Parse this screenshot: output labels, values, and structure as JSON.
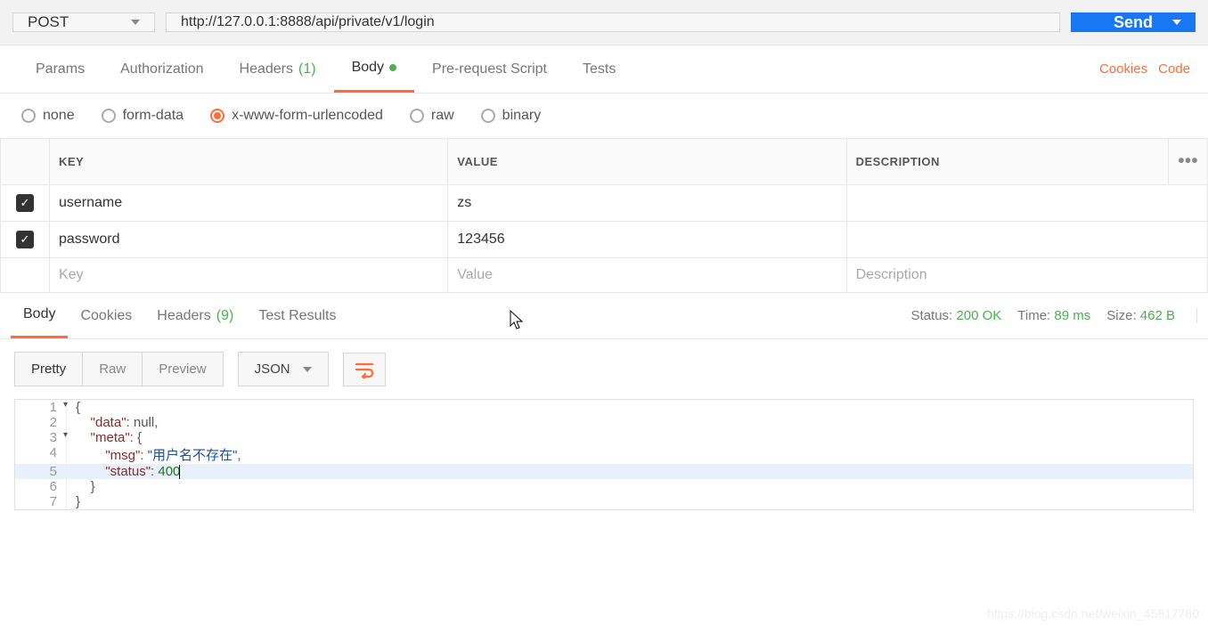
{
  "request": {
    "method": "POST",
    "url": "http://127.0.0.1:8888/api/private/v1/login",
    "send_label": "Send"
  },
  "tabs": {
    "params": "Params",
    "authorization": "Authorization",
    "headers": "Headers",
    "headers_count": "(1)",
    "body": "Body",
    "prerequest": "Pre-request Script",
    "tests": "Tests"
  },
  "links": {
    "cookies": "Cookies",
    "code": "Code"
  },
  "body_types": {
    "none": "none",
    "formdata": "form-data",
    "urlencoded": "x-www-form-urlencoded",
    "raw": "raw",
    "binary": "binary"
  },
  "kv": {
    "key_header": "KEY",
    "value_header": "VALUE",
    "desc_header": "DESCRIPTION",
    "rows": [
      {
        "key": "username",
        "value": "zs",
        "desc": ""
      },
      {
        "key": "password",
        "value": "123456",
        "desc": ""
      }
    ],
    "placeholders": {
      "key": "Key",
      "value": "Value",
      "desc": "Description"
    }
  },
  "response_tabs": {
    "body": "Body",
    "cookies": "Cookies",
    "headers": "Headers",
    "headers_count": "(9)",
    "test_results": "Test Results"
  },
  "status": {
    "status_label": "Status:",
    "status_value": "200 OK",
    "time_label": "Time:",
    "time_value": "89 ms",
    "size_label": "Size:",
    "size_value": "462 B"
  },
  "view": {
    "pretty": "Pretty",
    "raw": "Raw",
    "preview": "Preview",
    "lang": "JSON"
  },
  "response_body": {
    "line1_brace": "{",
    "line2_key": "\"data\"",
    "line2_sep": ": ",
    "line2_val": "null",
    "line2_comma": ",",
    "line3_key": "\"meta\"",
    "line3_sep": ": {",
    "line4_key": "\"msg\"",
    "line4_sep": ": ",
    "line4_val": "\"用户名不存在\"",
    "line4_comma": ",",
    "line5_key": "\"status\"",
    "line5_sep": ": ",
    "line5_val": "400",
    "line6_brace": "}",
    "line7_brace": "}"
  },
  "watermark": "https://blog.csdn.net/weixin_45817780"
}
